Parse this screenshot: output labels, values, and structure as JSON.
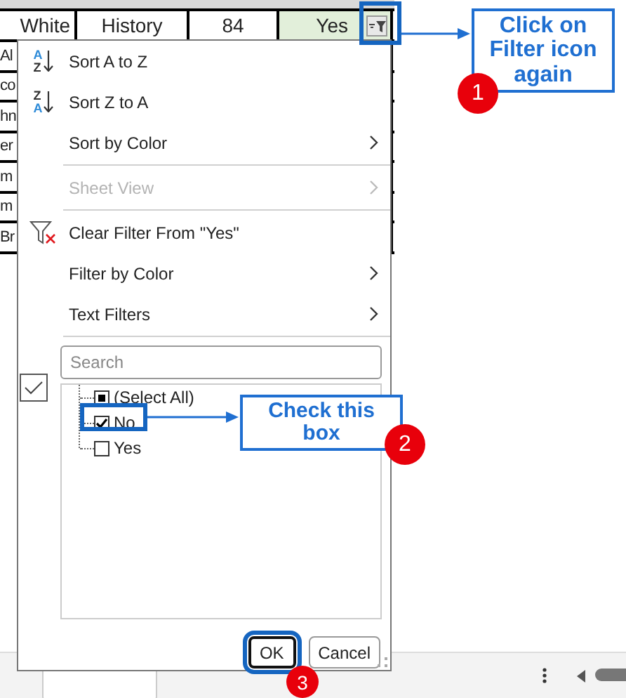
{
  "sheet": {
    "first_row": [
      "White",
      "History",
      "84",
      "Yes"
    ],
    "filter_applied": true,
    "column_a_fragments": [
      "Al",
      "co",
      "hn",
      "er",
      "m",
      "m",
      "Br"
    ]
  },
  "menu": {
    "items": [
      {
        "kind": "sort",
        "letters": [
          {
            "text": "A",
            "highlighted": true
          },
          {
            "text": "Z",
            "highlighted": false
          }
        ],
        "label": "Sort A to Z"
      },
      {
        "kind": "sort",
        "letters": [
          {
            "text": "Z",
            "highlighted": false
          },
          {
            "text": "A",
            "highlighted": true
          }
        ],
        "label": "Sort Z to A"
      },
      {
        "kind": "submenu",
        "label": "Sort by Color",
        "disabled": false
      },
      {
        "kind": "divider"
      },
      {
        "kind": "submenu",
        "label": "Sheet View",
        "disabled": true
      },
      {
        "kind": "divider"
      },
      {
        "kind": "clear",
        "label": "Clear Filter From \"Yes\""
      },
      {
        "kind": "submenu",
        "label": "Filter by Color",
        "disabled": false
      },
      {
        "kind": "submenu",
        "label": "Text Filters",
        "disabled": false
      },
      {
        "kind": "divider"
      }
    ],
    "search": {
      "placeholder": "Search"
    },
    "values": [
      {
        "label": "(Select All)",
        "checked": false,
        "partial": true
      },
      {
        "label": "No",
        "checked": true,
        "partial": false
      },
      {
        "label": "Yes",
        "checked": false,
        "partial": false
      }
    ],
    "buttons": [
      {
        "label": "OK",
        "default": true
      },
      {
        "label": "Cancel",
        "default": false
      }
    ]
  },
  "annotations": [
    {
      "number": "1",
      "text": "Click on Filter icon again"
    },
    {
      "number": "2",
      "text": "Check this box"
    },
    {
      "number": "3"
    }
  ]
}
